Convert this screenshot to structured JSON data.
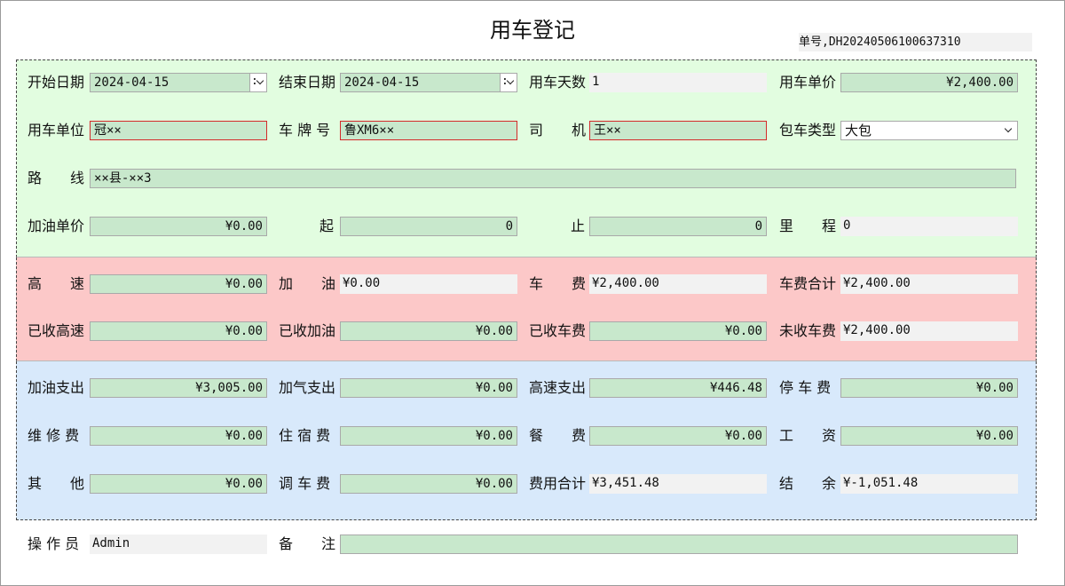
{
  "title": "用车登记",
  "doc_no": "单号,DH20240506100637310",
  "section1": {
    "start_date": {
      "label": "开始日期",
      "value": "2024-04-15"
    },
    "end_date": {
      "label": "结束日期",
      "value": "2024-04-15"
    },
    "days": {
      "label": "用车天数",
      "value": "1"
    },
    "unit_price": {
      "label": "用车单价",
      "value": "¥2,400.00"
    },
    "unit": {
      "label": "用车单位",
      "value": "冠××"
    },
    "plate": {
      "label": "车 牌 号",
      "value": "鲁XM6××"
    },
    "driver": {
      "label": "司　　机",
      "value": "王××"
    },
    "charter_type": {
      "label": "包车类型",
      "value": "大包"
    },
    "route": {
      "label": "路　　线",
      "value": "××县-××3"
    },
    "fuel_price": {
      "label": "加油单价",
      "value": "¥0.00"
    },
    "start_km": {
      "label": "起",
      "value": "0"
    },
    "end_km": {
      "label": "止",
      "value": "0"
    },
    "mileage": {
      "label": "里　　程",
      "value": "0"
    }
  },
  "section2": {
    "highway": {
      "label": "高　　速",
      "value": "¥0.00"
    },
    "fuel": {
      "label": "加　　油",
      "value": "¥0.00"
    },
    "fee": {
      "label": "车　　费",
      "value": "¥2,400.00"
    },
    "fee_total": {
      "label": "车费合计",
      "value": "¥2,400.00"
    },
    "recv_highway": {
      "label": "已收高速",
      "value": "¥0.00"
    },
    "recv_fuel": {
      "label": "已收加油",
      "value": "¥0.00"
    },
    "recv_fee": {
      "label": "已收车费",
      "value": "¥0.00"
    },
    "unrecv_fee": {
      "label": "未收车费",
      "value": "¥2,400.00"
    }
  },
  "section3": {
    "fuel_cost": {
      "label": "加油支出",
      "value": "¥3,005.00"
    },
    "gas_cost": {
      "label": "加气支出",
      "value": "¥0.00"
    },
    "highway_cost": {
      "label": "高速支出",
      "value": "¥446.48"
    },
    "parking": {
      "label": "停 车 费",
      "value": "¥0.00"
    },
    "repair": {
      "label": "维 修 费",
      "value": "¥0.00"
    },
    "lodging": {
      "label": "住 宿 费",
      "value": "¥0.00"
    },
    "meals": {
      "label": "餐　　费",
      "value": "¥0.00"
    },
    "wages": {
      "label": "工　　资",
      "value": "¥0.00"
    },
    "other": {
      "label": "其　　他",
      "value": "¥0.00"
    },
    "dispatch": {
      "label": "调 车 费",
      "value": "¥0.00"
    },
    "cost_total": {
      "label": "费用合计",
      "value": "¥3,451.48"
    },
    "balance": {
      "label": "结　　余",
      "value": "¥-1,051.48"
    }
  },
  "footer": {
    "operator": {
      "label": "操 作 员",
      "value": "Admin"
    },
    "remark": {
      "label": "备　　注",
      "value": ""
    }
  }
}
